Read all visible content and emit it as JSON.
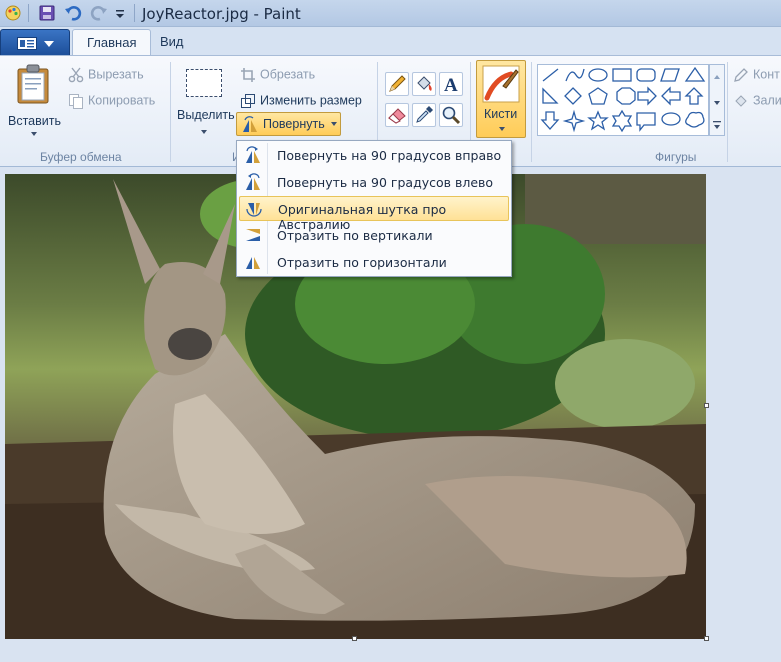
{
  "window": {
    "title": "JoyReactor.jpg - Paint"
  },
  "tabs": [
    {
      "label": "Главная",
      "active": true
    },
    {
      "label": "Вид",
      "active": false
    }
  ],
  "clipboard": {
    "paste_label": "Вставить",
    "cut_label": "Вырезать",
    "copy_label": "Копировать",
    "group_label": "Буфер обмена"
  },
  "image": {
    "select_label": "Выделить",
    "crop_label": "Обрезать",
    "resize_label": "Изменить размер",
    "rotate_label": "Повернуть",
    "group_label_partial": "И"
  },
  "brushes": {
    "label": "Кисти"
  },
  "shapes": {
    "group_label": "Фигуры",
    "outline_label": "Конт",
    "fill_label": "Зали"
  },
  "rotate_menu": [
    {
      "label": "Повернуть на 90 градусов вправо",
      "highlighted": false,
      "icon": "rotate-right-icon"
    },
    {
      "label": "Повернуть на 90 градусов влево",
      "highlighted": false,
      "icon": "rotate-left-icon"
    },
    {
      "label": "Оригинальная шутка про Австралию",
      "highlighted": true,
      "icon": "rotate-180-icon"
    },
    {
      "label": "Отразить по вертикали",
      "highlighted": false,
      "icon": "flip-vertical-icon"
    },
    {
      "label": "Отразить по горизонтали",
      "highlighted": false,
      "icon": "flip-horizontal-icon"
    }
  ],
  "colors": {
    "accent": "#ffcc58",
    "ribbon_bg": "#e3ebf6",
    "canvas_bg": "#d9e3f1"
  }
}
